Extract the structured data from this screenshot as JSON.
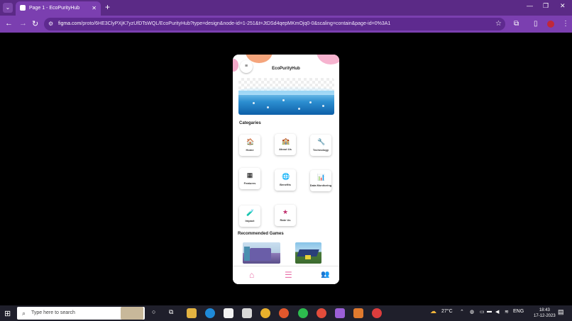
{
  "browser": {
    "tab_title": "Page 1 - EcoPurityHub",
    "tab_close": "✕",
    "new_tab": "+",
    "url_domain": "figma.com",
    "url_path": "/proto/6HE3ClyPXjK7yzUfDTsWQL/EcoPurityHub?type=design&node-id=1-251&t=JtDSd4qepMKmOjq0-0&scaling=contain&page-id=0%3A1",
    "min": "—",
    "restore": "❐",
    "close": "✕",
    "back": "←",
    "forward": "→",
    "reload": "↻"
  },
  "app": {
    "title": "EcoPurityHub",
    "menu_glyph": "≡",
    "categories_heading": "Categaries",
    "categories": [
      {
        "label": "Home",
        "icon": "🏠"
      },
      {
        "label": "About Us",
        "icon": "🏫"
      },
      {
        "label": "Technology",
        "icon": "🔧"
      },
      {
        "label": "Features",
        "icon": "▦"
      },
      {
        "label": "Benefits",
        "icon": "🌐"
      },
      {
        "label": "Data Monitoring",
        "icon": "📊"
      },
      {
        "label": "Impact",
        "icon": "🧪"
      },
      {
        "label": "Rate Us",
        "icon": "★"
      }
    ],
    "recommended_heading": "Recommended Games",
    "nav": {
      "home": "⌂",
      "menu": "☰",
      "users": "👥"
    }
  },
  "taskbar": {
    "search_placeholder": "Type here to search",
    "temperature": "27°C",
    "language": "ENG",
    "time": "18:43",
    "date": "17-12-2023"
  },
  "colors": {
    "accent_pink": "#e86fa8",
    "browser_purple": "#7b3fb0"
  }
}
